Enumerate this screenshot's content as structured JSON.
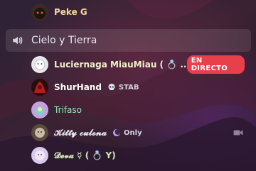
{
  "channel": {
    "name": "Cielo y Tierra"
  },
  "live_label": "EN DIRECTO",
  "members": [
    {
      "name": "Peke G",
      "color": "#f4d8a6"
    },
    {
      "name": "Luciernaga MiauMiau ( 💍 ...",
      "color": "#eef2c8"
    },
    {
      "name": "ShurHand",
      "color": "#ffffff",
      "tag": "STAB"
    },
    {
      "name": "Trifaso",
      "color": "#9ee4b7"
    },
    {
      "name": "𝓚𝓲𝓽𝓽𝔂 𝓬𝓾𝓵𝓸𝓷𝓪",
      "color": "#e7e4f2",
      "tag": "Only"
    },
    {
      "name": "𝓓𝓮𝓿𝓪 ☿ ( 💍 Y)",
      "color": "#cfe9b6"
    }
  ],
  "icons": {
    "channel": "speaker-icon",
    "shurhand_badge": "skull-icon",
    "kitty_badge": "crescent-icon",
    "video": "video-camera-icon"
  }
}
